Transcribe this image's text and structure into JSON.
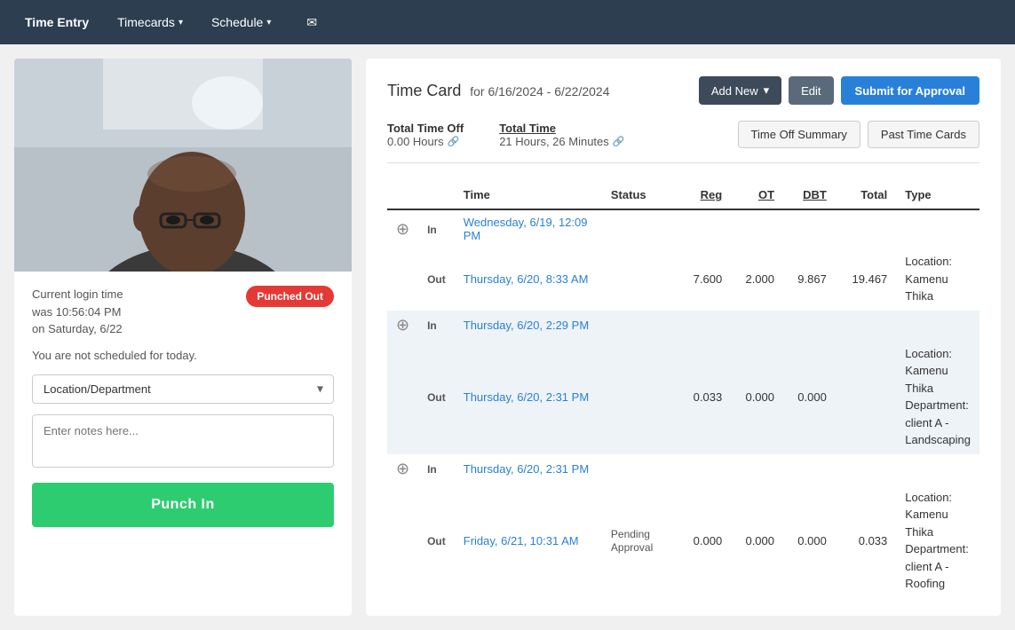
{
  "navbar": {
    "items": [
      {
        "label": "Time Entry",
        "active": true,
        "has_dropdown": false
      },
      {
        "label": "Timecards",
        "active": false,
        "has_dropdown": true
      },
      {
        "label": "Schedule",
        "active": false,
        "has_dropdown": true
      }
    ],
    "mail_icon": "mail-icon"
  },
  "left_panel": {
    "login_time_line1": "Current login time",
    "login_time_line2": "was 10:56:04 PM",
    "login_date": "on Saturday, 6/22",
    "status_badge": "Punched Out",
    "not_scheduled": "You are not scheduled for today.",
    "location_placeholder": "Location/Department",
    "notes_placeholder": "Enter notes here...",
    "punch_in_label": "Punch In"
  },
  "right_panel": {
    "title": "Time Card",
    "date_range": "for 6/16/2024 - 6/22/2024",
    "btn_add_new": "Add New",
    "btn_edit": "Edit",
    "btn_submit": "Submit for Approval",
    "total_time_off_label": "Total Time Off",
    "total_time_off_value": "0.00 Hours",
    "total_time_label": "Total Time",
    "total_time_value": "21 Hours, 26 Minutes",
    "btn_time_off_summary": "Time Off Summary",
    "btn_past_time_cards": "Past Time Cards",
    "table": {
      "headers": [
        {
          "label": "",
          "key": "icon"
        },
        {
          "label": "",
          "key": "inout"
        },
        {
          "label": "Time",
          "key": "time"
        },
        {
          "label": "Status",
          "key": "status"
        },
        {
          "label": "Reg",
          "key": "reg",
          "underline": true
        },
        {
          "label": "OT",
          "key": "ot",
          "underline": true
        },
        {
          "label": "DBT",
          "key": "dbt",
          "underline": true
        },
        {
          "label": "Total",
          "key": "total"
        },
        {
          "label": "Type",
          "key": "type"
        }
      ],
      "row_groups": [
        {
          "shaded": false,
          "rows": [
            {
              "show_add": true,
              "inout": "In",
              "time": "Wednesday, 6/19, 12:09 PM",
              "status": "",
              "reg": "",
              "ot": "",
              "dbt": "",
              "total": "",
              "type": ""
            },
            {
              "show_add": false,
              "inout": "Out",
              "time": "Thursday, 6/20, 8:33 AM",
              "status": "",
              "reg": "7.600",
              "ot": "2.000",
              "dbt": "9.867",
              "total": "19.467",
              "type": "Location: Kamenu Thika"
            }
          ]
        },
        {
          "shaded": true,
          "rows": [
            {
              "show_add": true,
              "inout": "In",
              "time": "Thursday, 6/20, 2:29 PM",
              "status": "",
              "reg": "",
              "ot": "",
              "dbt": "",
              "total": "",
              "type": ""
            },
            {
              "show_add": false,
              "inout": "Out",
              "time": "Thursday, 6/20, 2:31 PM",
              "status": "",
              "reg": "0.033",
              "ot": "0.000",
              "dbt": "0.000",
              "total": "",
              "type": "Location: Kamenu Thika\nDepartment: client A - Landscaping"
            }
          ]
        },
        {
          "shaded": false,
          "rows": [
            {
              "show_add": true,
              "inout": "In",
              "time": "Thursday, 6/20, 2:31 PM",
              "status": "",
              "reg": "",
              "ot": "",
              "dbt": "",
              "total": "",
              "type": ""
            },
            {
              "show_add": false,
              "inout": "Out",
              "time": "Friday, 6/21, 10:31 AM",
              "status": "Pending Approval",
              "reg": "0.000",
              "ot": "0.000",
              "dbt": "0.000",
              "total": "0.033",
              "type": "Location: Kamenu Thika\nDepartment: client A - Roofing"
            }
          ]
        }
      ]
    }
  }
}
